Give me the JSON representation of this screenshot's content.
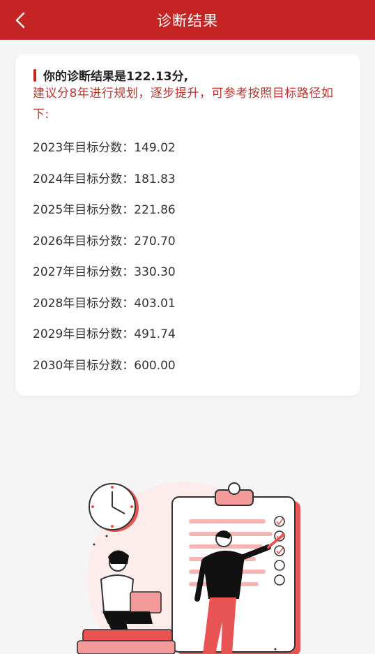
{
  "header": {
    "title": "诊断结果",
    "back_icon": "chevron-left-icon"
  },
  "result": {
    "headline": "你的诊断结果是122.13分,",
    "advice": "建议分8年进行规划，逐步提升，可参考按照目标路径如下:",
    "targets": [
      "2023年目标分数：149.02",
      "2024年目标分数：181.83",
      "2025年目标分数：221.86",
      "2026年目标分数：270.70",
      "2027年目标分数：330.30",
      "2028年目标分数：403.01",
      "2029年目标分数：491.74",
      "2030年目标分数：600.00"
    ]
  },
  "colors": {
    "brand": "#c52424",
    "advice_text": "#b8362f",
    "background": "#f5f5f5"
  },
  "illustration": "planning-illustration"
}
